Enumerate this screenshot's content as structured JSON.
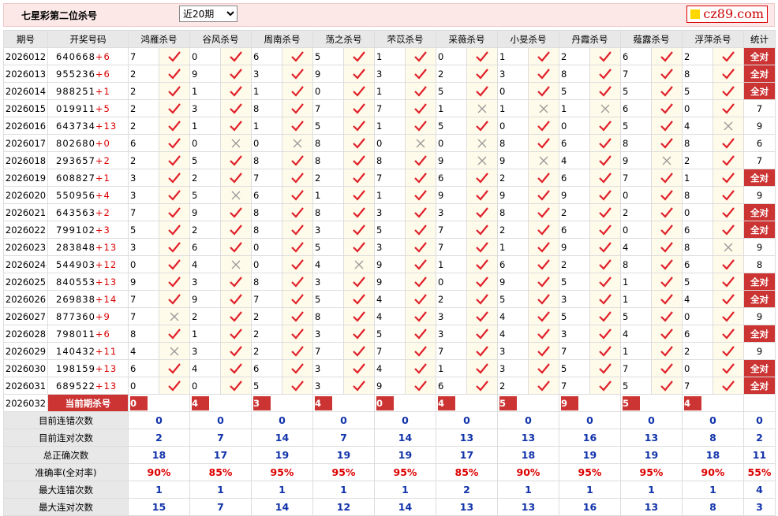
{
  "header": {
    "title": "七星彩第二位杀号",
    "period_select": "近20期",
    "logo": "cz89.com"
  },
  "columns": [
    "期号",
    "开奖号码",
    "鸿雁杀号",
    "谷风杀号",
    "周南杀号",
    "荡之杀号",
    "芣苡杀号",
    "采薇杀号",
    "小旻杀号",
    "丹霞杀号",
    "薤露杀号",
    "浮萍杀号",
    "统计"
  ],
  "rows": [
    {
      "issue": "2026012",
      "num": "640668",
      "sp": "+6",
      "k": [
        [
          7,
          1
        ],
        [
          0,
          1
        ],
        [
          6,
          1
        ],
        [
          5,
          1
        ],
        [
          1,
          1
        ],
        [
          0,
          1
        ],
        [
          1,
          1
        ],
        [
          2,
          1
        ],
        [
          6,
          1
        ],
        [
          2,
          1
        ]
      ],
      "t": "全对"
    },
    {
      "issue": "2026013",
      "num": "955236",
      "sp": "+6",
      "k": [
        [
          2,
          1
        ],
        [
          9,
          1
        ],
        [
          3,
          1
        ],
        [
          9,
          1
        ],
        [
          3,
          1
        ],
        [
          2,
          1
        ],
        [
          3,
          1
        ],
        [
          8,
          1
        ],
        [
          7,
          1
        ],
        [
          8,
          1
        ]
      ],
      "t": "全对"
    },
    {
      "issue": "2026014",
      "num": "988251",
      "sp": "+1",
      "k": [
        [
          2,
          1
        ],
        [
          1,
          1
        ],
        [
          1,
          1
        ],
        [
          0,
          1
        ],
        [
          1,
          1
        ],
        [
          5,
          1
        ],
        [
          0,
          1
        ],
        [
          5,
          1
        ],
        [
          5,
          1
        ],
        [
          5,
          1
        ]
      ],
      "t": "全对"
    },
    {
      "issue": "2026015",
      "num": "019911",
      "sp": "+5",
      "k": [
        [
          2,
          1
        ],
        [
          3,
          1
        ],
        [
          8,
          1
        ],
        [
          7,
          1
        ],
        [
          7,
          1
        ],
        [
          1,
          0
        ],
        [
          1,
          0
        ],
        [
          1,
          0
        ],
        [
          6,
          1
        ],
        [
          0,
          1
        ]
      ],
      "t": "7"
    },
    {
      "issue": "2026016",
      "num": "643734",
      "sp": "+13",
      "k": [
        [
          2,
          1
        ],
        [
          1,
          1
        ],
        [
          1,
          1
        ],
        [
          5,
          1
        ],
        [
          1,
          1
        ],
        [
          5,
          1
        ],
        [
          0,
          1
        ],
        [
          0,
          1
        ],
        [
          5,
          1
        ],
        [
          4,
          0
        ]
      ],
      "t": "9"
    },
    {
      "issue": "2026017",
      "num": "802680",
      "sp": "+0",
      "k": [
        [
          6,
          1
        ],
        [
          0,
          0
        ],
        [
          0,
          0
        ],
        [
          8,
          1
        ],
        [
          0,
          0
        ],
        [
          0,
          0
        ],
        [
          8,
          1
        ],
        [
          6,
          1
        ],
        [
          8,
          1
        ],
        [
          8,
          1
        ]
      ],
      "t": "6"
    },
    {
      "issue": "2026018",
      "num": "293657",
      "sp": "+2",
      "k": [
        [
          2,
          1
        ],
        [
          5,
          1
        ],
        [
          8,
          1
        ],
        [
          8,
          1
        ],
        [
          8,
          1
        ],
        [
          9,
          0
        ],
        [
          9,
          0
        ],
        [
          4,
          1
        ],
        [
          9,
          0
        ],
        [
          2,
          1
        ]
      ],
      "t": "7"
    },
    {
      "issue": "2026019",
      "num": "608827",
      "sp": "+1",
      "k": [
        [
          3,
          1
        ],
        [
          2,
          1
        ],
        [
          7,
          1
        ],
        [
          2,
          1
        ],
        [
          7,
          1
        ],
        [
          6,
          1
        ],
        [
          2,
          1
        ],
        [
          6,
          1
        ],
        [
          7,
          1
        ],
        [
          1,
          1
        ]
      ],
      "t": "全对"
    },
    {
      "issue": "2026020",
      "num": "550956",
      "sp": "+4",
      "k": [
        [
          3,
          1
        ],
        [
          5,
          0
        ],
        [
          6,
          1
        ],
        [
          1,
          1
        ],
        [
          1,
          1
        ],
        [
          9,
          1
        ],
        [
          9,
          1
        ],
        [
          9,
          1
        ],
        [
          0,
          1
        ],
        [
          8,
          1
        ]
      ],
      "t": "9"
    },
    {
      "issue": "2026021",
      "num": "643563",
      "sp": "+2",
      "k": [
        [
          7,
          1
        ],
        [
          9,
          1
        ],
        [
          8,
          1
        ],
        [
          8,
          1
        ],
        [
          3,
          1
        ],
        [
          3,
          1
        ],
        [
          8,
          1
        ],
        [
          2,
          1
        ],
        [
          2,
          1
        ],
        [
          0,
          1
        ]
      ],
      "t": "全对"
    },
    {
      "issue": "2026022",
      "num": "799102",
      "sp": "+3",
      "k": [
        [
          5,
          1
        ],
        [
          2,
          1
        ],
        [
          8,
          1
        ],
        [
          3,
          1
        ],
        [
          5,
          1
        ],
        [
          7,
          1
        ],
        [
          2,
          1
        ],
        [
          6,
          1
        ],
        [
          0,
          1
        ],
        [
          6,
          1
        ]
      ],
      "t": "全对"
    },
    {
      "issue": "2026023",
      "num": "283848",
      "sp": "+13",
      "k": [
        [
          3,
          1
        ],
        [
          6,
          1
        ],
        [
          0,
          1
        ],
        [
          5,
          1
        ],
        [
          3,
          1
        ],
        [
          7,
          1
        ],
        [
          1,
          1
        ],
        [
          9,
          1
        ],
        [
          4,
          1
        ],
        [
          8,
          0
        ]
      ],
      "t": "9"
    },
    {
      "issue": "2026024",
      "num": "544903",
      "sp": "+12",
      "k": [
        [
          0,
          1
        ],
        [
          4,
          0
        ],
        [
          0,
          1
        ],
        [
          4,
          0
        ],
        [
          9,
          1
        ],
        [
          1,
          1
        ],
        [
          6,
          1
        ],
        [
          2,
          1
        ],
        [
          8,
          1
        ],
        [
          6,
          1
        ]
      ],
      "t": "8"
    },
    {
      "issue": "2026025",
      "num": "840553",
      "sp": "+13",
      "k": [
        [
          9,
          1
        ],
        [
          3,
          1
        ],
        [
          8,
          1
        ],
        [
          3,
          1
        ],
        [
          9,
          1
        ],
        [
          0,
          1
        ],
        [
          9,
          1
        ],
        [
          5,
          1
        ],
        [
          1,
          1
        ],
        [
          5,
          1
        ]
      ],
      "t": "全对"
    },
    {
      "issue": "2026026",
      "num": "269838",
      "sp": "+14",
      "k": [
        [
          7,
          1
        ],
        [
          9,
          1
        ],
        [
          7,
          1
        ],
        [
          5,
          1
        ],
        [
          4,
          1
        ],
        [
          2,
          1
        ],
        [
          5,
          1
        ],
        [
          3,
          1
        ],
        [
          1,
          1
        ],
        [
          4,
          1
        ]
      ],
      "t": "全对"
    },
    {
      "issue": "2026027",
      "num": "877360",
      "sp": "+9",
      "k": [
        [
          7,
          0
        ],
        [
          2,
          1
        ],
        [
          2,
          1
        ],
        [
          8,
          1
        ],
        [
          4,
          1
        ],
        [
          3,
          1
        ],
        [
          4,
          1
        ],
        [
          5,
          1
        ],
        [
          5,
          1
        ],
        [
          0,
          1
        ]
      ],
      "t": "9"
    },
    {
      "issue": "2026028",
      "num": "798011",
      "sp": "+6",
      "k": [
        [
          8,
          1
        ],
        [
          1,
          1
        ],
        [
          2,
          1
        ],
        [
          3,
          1
        ],
        [
          5,
          1
        ],
        [
          3,
          1
        ],
        [
          4,
          1
        ],
        [
          3,
          1
        ],
        [
          4,
          1
        ],
        [
          6,
          1
        ]
      ],
      "t": "全对"
    },
    {
      "issue": "2026029",
      "num": "140432",
      "sp": "+11",
      "k": [
        [
          4,
          0
        ],
        [
          3,
          1
        ],
        [
          2,
          1
        ],
        [
          7,
          1
        ],
        [
          7,
          1
        ],
        [
          7,
          1
        ],
        [
          3,
          1
        ],
        [
          7,
          1
        ],
        [
          1,
          1
        ],
        [
          2,
          1
        ]
      ],
      "t": "9"
    },
    {
      "issue": "2026030",
      "num": "198159",
      "sp": "+13",
      "k": [
        [
          6,
          1
        ],
        [
          4,
          1
        ],
        [
          6,
          1
        ],
        [
          3,
          1
        ],
        [
          4,
          1
        ],
        [
          1,
          1
        ],
        [
          3,
          1
        ],
        [
          5,
          1
        ],
        [
          7,
          1
        ],
        [
          0,
          1
        ]
      ],
      "t": "全对"
    },
    {
      "issue": "2026031",
      "num": "689522",
      "sp": "+13",
      "k": [
        [
          0,
          1
        ],
        [
          0,
          1
        ],
        [
          5,
          1
        ],
        [
          3,
          1
        ],
        [
          9,
          1
        ],
        [
          6,
          1
        ],
        [
          2,
          1
        ],
        [
          7,
          1
        ],
        [
          5,
          1
        ],
        [
          7,
          1
        ]
      ],
      "t": "全对"
    }
  ],
  "current": {
    "issue": "2026032",
    "label": "当前期杀号",
    "values": [
      "0",
      "4",
      "3",
      "4",
      "0",
      "4",
      "5",
      "9",
      "5",
      "4"
    ]
  },
  "stats": [
    {
      "label": "目前连错次数",
      "v": [
        "0",
        "0",
        "0",
        "0",
        "0",
        "0",
        "0",
        "0",
        "0",
        "0",
        "0"
      ]
    },
    {
      "label": "目前连对次数",
      "v": [
        "2",
        "7",
        "14",
        "7",
        "14",
        "13",
        "13",
        "16",
        "13",
        "8",
        "2"
      ]
    },
    {
      "label": "总正确次数",
      "v": [
        "18",
        "17",
        "19",
        "19",
        "19",
        "17",
        "18",
        "19",
        "19",
        "18",
        "11"
      ]
    },
    {
      "label": "准确率(全对率)",
      "v": [
        "90%",
        "85%",
        "95%",
        "95%",
        "95%",
        "85%",
        "90%",
        "95%",
        "95%",
        "90%",
        "55%"
      ],
      "red": true
    },
    {
      "label": "最大连错次数",
      "v": [
        "1",
        "1",
        "1",
        "1",
        "1",
        "2",
        "1",
        "1",
        "1",
        "1",
        "4"
      ]
    },
    {
      "label": "最大连对次数",
      "v": [
        "15",
        "7",
        "14",
        "12",
        "14",
        "13",
        "13",
        "16",
        "13",
        "8",
        "3"
      ]
    }
  ]
}
